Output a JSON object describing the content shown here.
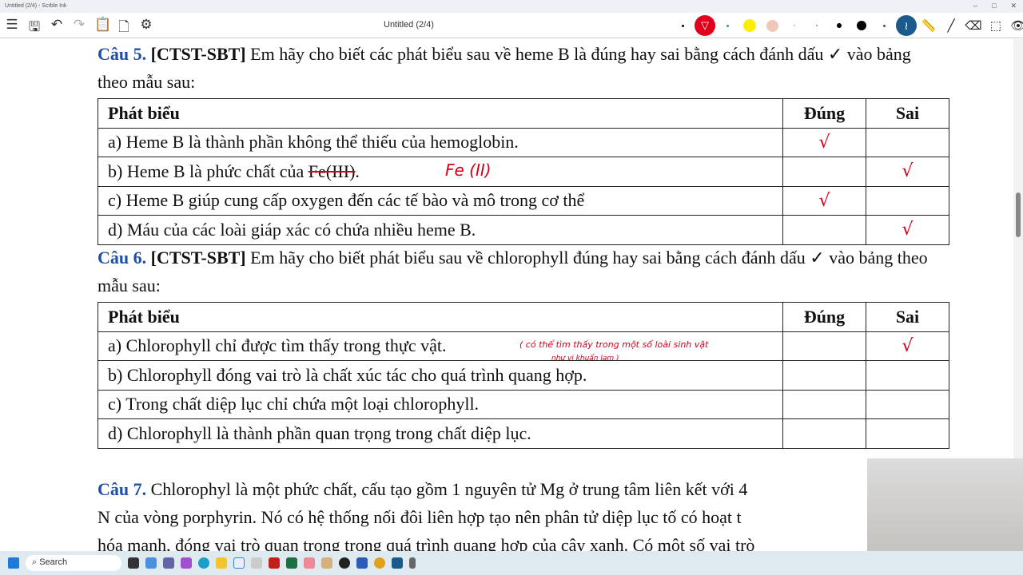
{
  "window": {
    "title": "Untitled (2/4) - Scrble Ink",
    "doc_title": "Untitled (2/4)",
    "controls": [
      "–",
      "□",
      "✕"
    ]
  },
  "toolbar": {
    "left_icons": [
      "menu-icon",
      "save-icon",
      "undo-icon",
      "redo-icon",
      "paste-icon",
      "new-page-icon",
      "settings-sliders-icon"
    ],
    "colors": {
      "pen": "#e0001b",
      "highlighter": "#ffee00",
      "peach": "#f0c8b8",
      "active_tool": "#1a5a8c"
    }
  },
  "q5": {
    "label": "Câu 5.",
    "tag": "[CTST-SBT]",
    "text": "Em hãy cho biết các phát biểu sau về heme B là đúng hay sai bằng cách đánh dấu ✓ vào bảng theo mẫu sau:",
    "headers": [
      "Phát biểu",
      "Đúng",
      "Sai"
    ],
    "rows": [
      {
        "text": "a) Heme B là thành phần không thể thiếu của hemoglobin.",
        "dung": "√",
        "sai": ""
      },
      {
        "text_pre": "b) Heme B là phức chất của ",
        "text_strike": "Fe(III)",
        "text_post": ".",
        "dung": "",
        "sai": "√",
        "note": "Fe (II)"
      },
      {
        "text": "c) Heme B giúp cung cấp oxygen đến các tế bào và mô trong cơ thể",
        "dung": "√",
        "sai": ""
      },
      {
        "text": "d) Máu của các loài giáp xác có chứa nhiều heme B.",
        "dung": "",
        "sai": "√"
      }
    ]
  },
  "q6": {
    "label": "Câu 6.",
    "tag": "[CTST-SBT]",
    "text": "Em hãy cho biết phát biểu sau về chlorophyll đúng hay sai bằng cách đánh dấu ✓ vào bảng theo mẫu sau:",
    "headers": [
      "Phát biểu",
      "Đúng",
      "Sai"
    ],
    "rows": [
      {
        "text": "a) Chlorophyll chỉ được tìm thấy trong thực vật.",
        "dung": "",
        "sai": "√",
        "note1": "( có thể tìm thấy trong một số loài sinh vật",
        "note2": "như vi khuẩn lam )"
      },
      {
        "text": "b) Chlorophyll đóng vai trò là chất xúc tác cho quá trình quang hợp.",
        "dung": "",
        "sai": ""
      },
      {
        "text": "c) Trong chất diệp lục chỉ chứa một loại chlorophyll.",
        "dung": "",
        "sai": ""
      },
      {
        "text": "d) Chlorophyll là thành phần quan trọng trong chất diệp lục.",
        "dung": "",
        "sai": ""
      }
    ]
  },
  "q7": {
    "label": "Câu 7.",
    "lines": [
      "Chlorophyl là một phức chất, cấu tạo gồm 1 nguyên tử Mg ở trung tâm liên kết với 4",
      "N của vòng porphyrin. Nó có hệ thống nối đôi liên hợp tạo nên phân tử diệp lục tố có hoạt t",
      "hóa mạnh, đóng vai trò quan trong trong quá trình quang hợp của cây xanh. Có một số vai trò"
    ]
  },
  "taskbar": {
    "search": "Search"
  }
}
